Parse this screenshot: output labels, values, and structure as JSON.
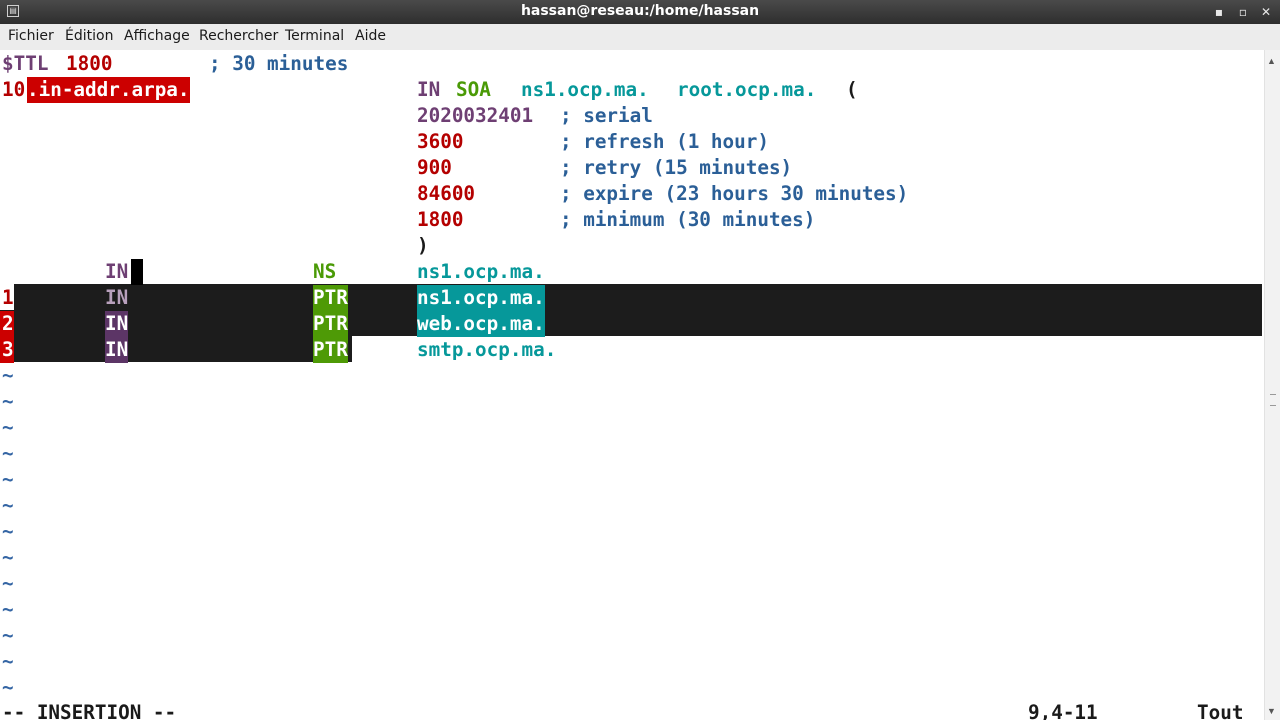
{
  "window": {
    "title": "hassan@reseau:/home/hassan",
    "minimize_glyph": "▪",
    "maximize_glyph": "▫",
    "close_glyph": "✕"
  },
  "menu": {
    "items": [
      "Fichier",
      "Édition",
      "Affichage",
      "Rechercher",
      "Terminal",
      "Aide"
    ]
  },
  "editor": {
    "ttl": {
      "keyword": "$TTL",
      "value": "1800",
      "comment": "; 30 minutes"
    },
    "origin": {
      "prefix": "10",
      "domain": ".in-addr.arpa.",
      "class": "IN",
      "type": "SOA",
      "primary_ns": "ns1.ocp.ma.",
      "admin": "root.ocp.ma.",
      "open": "("
    },
    "soa_fields": [
      {
        "value": "2020032401",
        "comment": "; serial"
      },
      {
        "value": "3600",
        "comment": "; refresh (1 hour)"
      },
      {
        "value": "900",
        "comment": "; retry (15 minutes)"
      },
      {
        "value": "84600",
        "comment": "; expire (23 hours 30 minutes)"
      },
      {
        "value": "1800",
        "comment": "; minimum (30 minutes)"
      }
    ],
    "close": ")",
    "records": [
      {
        "name": "",
        "class": "IN",
        "type": "NS",
        "target": "ns1.ocp.ma."
      },
      {
        "name": "1",
        "class": "IN",
        "type": "PTR",
        "target": "ns1.ocp.ma."
      },
      {
        "name": "2",
        "class": "IN",
        "type": "PTR",
        "target": "web.ocp.ma."
      },
      {
        "name": "3",
        "class": "IN",
        "type": "PTR",
        "target": "smtp.ocp.ma."
      }
    ],
    "empty_line_marker": "~"
  },
  "status_line": {
    "mode": "-- INSERTION --",
    "position": "9,4-11",
    "scroll": "Tout"
  },
  "colors": {
    "keyword_purple": "#6e3f73",
    "number_red": "#b40000",
    "comment_blue": "#2b5f97",
    "type_green": "#4a9a06",
    "domain_teal": "#06989a",
    "highlight_red": "#cc0000"
  }
}
